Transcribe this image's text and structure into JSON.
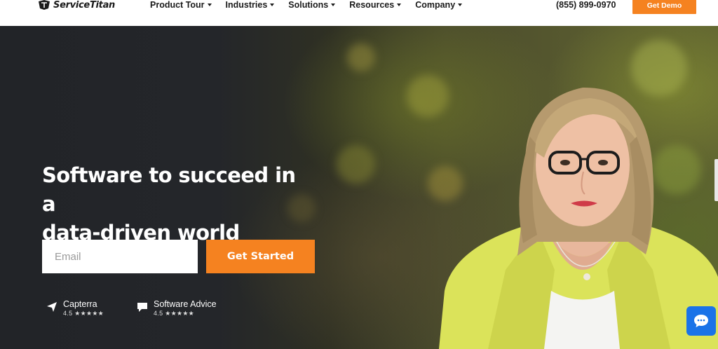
{
  "nav": {
    "logo_text": "ServiceTitan",
    "items": [
      {
        "label": "Product Tour"
      },
      {
        "label": "Industries"
      },
      {
        "label": "Solutions"
      },
      {
        "label": "Resources"
      },
      {
        "label": "Company"
      }
    ],
    "phone": "(855) 899-0970",
    "demo_label": "Get Demo"
  },
  "hero": {
    "headline_line1": "Software to succeed in a",
    "headline_line2": "data-driven world",
    "email_placeholder": "Email",
    "cta_label": "Get Started",
    "ratings": [
      {
        "name": "Capterra",
        "score": "4.5 ★★★★★",
        "icon": "paper-plane-icon"
      },
      {
        "name": "Software Advice",
        "score": "4.5 ★★★★★",
        "icon": "chat-bubble-icon"
      }
    ]
  },
  "colors": {
    "accent": "#f58220",
    "chat": "#1a73e8",
    "hero_dark": "#222428"
  }
}
